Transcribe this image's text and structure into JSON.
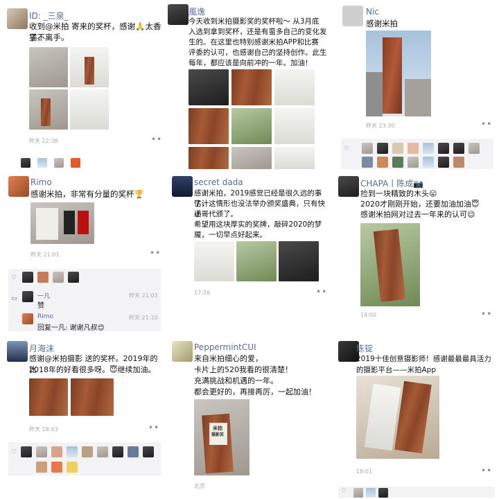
{
  "posts": [
    {
      "name": "ID: _三泉_",
      "text": [
        "收到@米拍 寄来的奖杯，感谢🙏太香了，",
        "猫不离手。"
      ],
      "time": "昨天 22:38",
      "more": "••"
    },
    {
      "name": "風逸",
      "text": [
        "今天收到米拍摄影奖的奖杯啦～ 从3月底",
        "入选到拿到奖杯，还是有蛮多自己的变化发",
        "生的。在这里也特别感谢米拍APP和比赛",
        "评委的认可，也感谢自己的坚持创作。此生",
        "每年，都应该是向前冲的一年。加油！"
      ],
      "time": "",
      "more": ""
    },
    {
      "name": "Nic",
      "text": [
        "感谢米拍"
      ],
      "time": "昨天 23:30",
      "more": "••"
    },
    {
      "name": "Rimo",
      "text": [
        "感谢米拍，非常有分量的奖杯🏆"
      ],
      "time": "昨天 21:01",
      "more": "••",
      "comments": [
        {
          "name": "一凡",
          "text": "赞",
          "time": "昨天 21:03"
        },
        {
          "name": "Rimo",
          "text": "回复一凡: 谢谢凡叔😊",
          "time": "昨天 21:10"
        }
      ]
    },
    {
      "name": "secret dada",
      "text": [
        "感谢米拍，2019感觉已经是很久远的事了，",
        "估计这情形也没法举办颁奖盛典，只有快递",
        "小哥代颁了。",
        "希望用这块厚实的奖牌，敲碎2020的梦",
        "魇，一切早点好起来。"
      ],
      "time": "17:26",
      "more": "••"
    },
    {
      "name": "CHAPA丨陈成📷",
      "text": [
        "捡到一块精致的木头😛",
        "2020才刚刚开始，还要加油加油😇",
        "感谢米拍网对过去一年来的认可😌"
      ],
      "time": "14:00",
      "more": "••"
    },
    {
      "name": "月海沫",
      "text": [
        "感谢@米拍摄影 送的奖杯。2019年的比",
        "2018年的好看很多呀。😇继续加油。"
      ],
      "time": "昨天 18:43",
      "more": "••"
    },
    {
      "name": "PeppermintCUI",
      "text": [
        "来自米拍细心的爱，",
        "卡片上的520我看的很清楚！",
        "充满挑战和机遇的一年。",
        "都会更好的，再接再厉，一起加油！"
      ],
      "time": "北京",
      "more": ""
    },
    {
      "name": "陈锭",
      "text": [
        "2019十佳创意摄影师！感谢最最最具活力",
        "的摄影平台——米拍App"
      ],
      "time": "18:01",
      "more": "••"
    }
  ],
  "trophy": {
    "line1": "米拍",
    "line2": "摄影奖"
  },
  "icons": {
    "like": "heart-icon",
    "comment": "comment-icon",
    "more": "more-dots-icon"
  },
  "colors": {
    "name": "#576b95",
    "time": "#a8a8a8",
    "likes_bg": "#f3f3f5"
  }
}
